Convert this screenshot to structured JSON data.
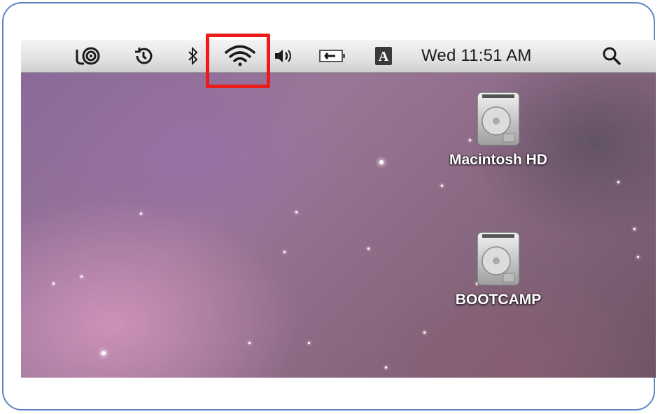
{
  "menubar": {
    "icons": [
      "screen-sharing-icon",
      "time-machine-icon",
      "bluetooth-icon",
      "wifi-icon",
      "volume-icon",
      "battery-icon",
      "input-menu-icon",
      "spotlight-icon"
    ],
    "input_menu_letter": "A",
    "clock": "Wed 11:51 AM"
  },
  "highlight": {
    "target": "wifi-icon",
    "color": "#ee1b1b"
  },
  "desktop": {
    "drives": [
      {
        "label": "Macintosh HD",
        "icon": "hard-drive-icon"
      },
      {
        "label": "BOOTCAMP",
        "icon": "hard-drive-icon"
      }
    ]
  },
  "colors": {
    "frame_border": "#5b86c5",
    "menubar": "#e2e2e2"
  }
}
